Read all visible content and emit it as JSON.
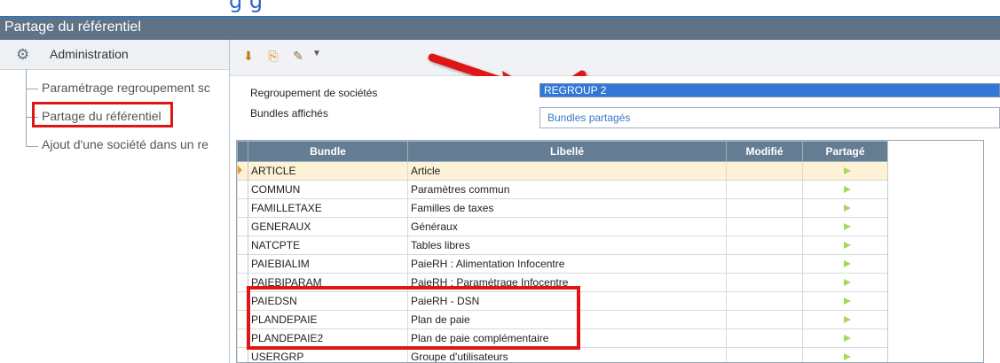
{
  "window": {
    "title": "Partage du référentiel"
  },
  "left_nav": {
    "section_label": "Administration",
    "section_icon": "admin-gear-icon",
    "items": [
      {
        "label": "Paramétrage regroupement sc"
      },
      {
        "label": "Partage du référentiel"
      },
      {
        "label": "Ajout d'une société dans un re"
      }
    ]
  },
  "toolbar": {
    "icons": [
      "export-icon",
      "document-arrow-icon",
      "wand-icon"
    ],
    "dropdown_icon": "chevron-down-icon"
  },
  "form": {
    "regroup_label": "Regroupement de sociétés",
    "regroup_value": "REGROUP 2",
    "bundles_label": "Bundles affichés",
    "bundles_value": "Bundles partagés"
  },
  "grid": {
    "columns": [
      "Bundle",
      "Libellé",
      "Modifié",
      "Partagé"
    ],
    "rows": [
      {
        "bundle": "ARTICLE",
        "libelle": "Article",
        "modifie": "",
        "partage": true,
        "selected": true
      },
      {
        "bundle": "COMMUN",
        "libelle": "Paramètres commun",
        "modifie": "",
        "partage": true
      },
      {
        "bundle": "FAMILLETAXE",
        "libelle": "Familles de taxes",
        "modifie": "",
        "partage": true
      },
      {
        "bundle": "GENERAUX",
        "libelle": "Généraux",
        "modifie": "",
        "partage": true
      },
      {
        "bundle": "NATCPTE",
        "libelle": "Tables libres",
        "modifie": "",
        "partage": true
      },
      {
        "bundle": "PAIEBIALIM",
        "libelle": "PaieRH : Alimentation Infocentre",
        "modifie": "",
        "partage": true
      },
      {
        "bundle": "PAIEBIPARAM",
        "libelle": "PaieRH : Paramétrage Infocentre",
        "modifie": "",
        "partage": true
      },
      {
        "bundle": "PAIEDSN",
        "libelle": "PaieRH - DSN",
        "modifie": "",
        "partage": true
      },
      {
        "bundle": "PLANDEPAIE",
        "libelle": "Plan de paie",
        "modifie": "",
        "partage": true
      },
      {
        "bundle": "PLANDEPAIE2",
        "libelle": "Plan de paie complémentaire",
        "modifie": "",
        "partage": true
      },
      {
        "bundle": "USERGRP",
        "libelle": "Groupe d'utilisateurs",
        "modifie": "",
        "partage": true
      }
    ]
  },
  "colors": {
    "title_bar": "#5f7386",
    "grid_header": "#647d93",
    "annotation_red": "#e01616",
    "selected_field": "#3377d6",
    "selected_row": "#fdf1d6",
    "partage_flag": "#a8d85a"
  }
}
